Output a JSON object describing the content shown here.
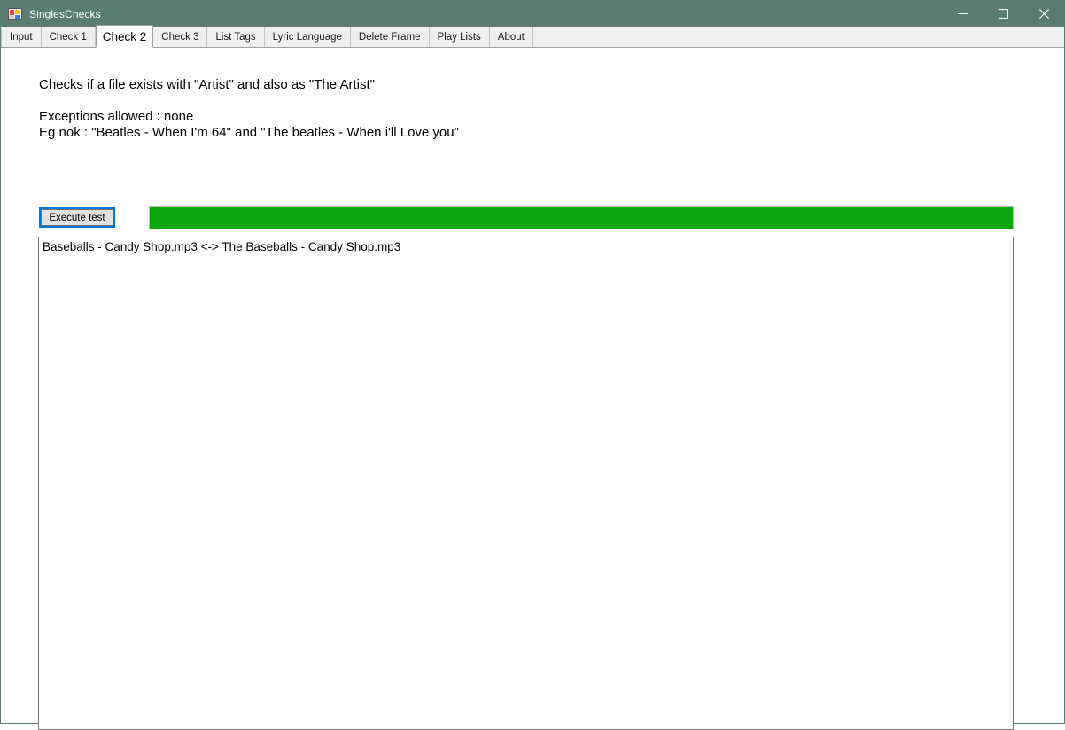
{
  "window": {
    "title": "SinglesChecks",
    "icon": "winforms-app-icon",
    "titlebar_color": "#587d72",
    "controls": [
      {
        "name": "minimize",
        "glyph": "–"
      },
      {
        "name": "maximize",
        "glyph": "□"
      },
      {
        "name": "close",
        "glyph": "✕"
      }
    ]
  },
  "tabs": [
    {
      "label": "Input",
      "selected": false
    },
    {
      "label": "Check 1",
      "selected": false
    },
    {
      "label": "Check 2",
      "selected": true
    },
    {
      "label": "Check 3",
      "selected": false
    },
    {
      "label": "List Tags",
      "selected": false
    },
    {
      "label": "Lyric Language",
      "selected": false
    },
    {
      "label": "Delete Frame",
      "selected": false
    },
    {
      "label": "Play Lists",
      "selected": false
    },
    {
      "label": "About",
      "selected": false
    }
  ],
  "main": {
    "description_line_1": "Checks if a file exists with \"Artist\" and also as \"The Artist\"",
    "exceptions_line": "Exceptions allowed : none",
    "example_line": "Eg nok : \"Beatles - When I'm 64\" and \"The beatles - When i'll Love you\"",
    "execute_button_label": "Execute test",
    "progress": {
      "percent": 100,
      "fill_color": "#0aa80a"
    },
    "results": [
      "Baseballs - Candy Shop.mp3 <-> The Baseballs - Candy Shop.mp3"
    ]
  }
}
